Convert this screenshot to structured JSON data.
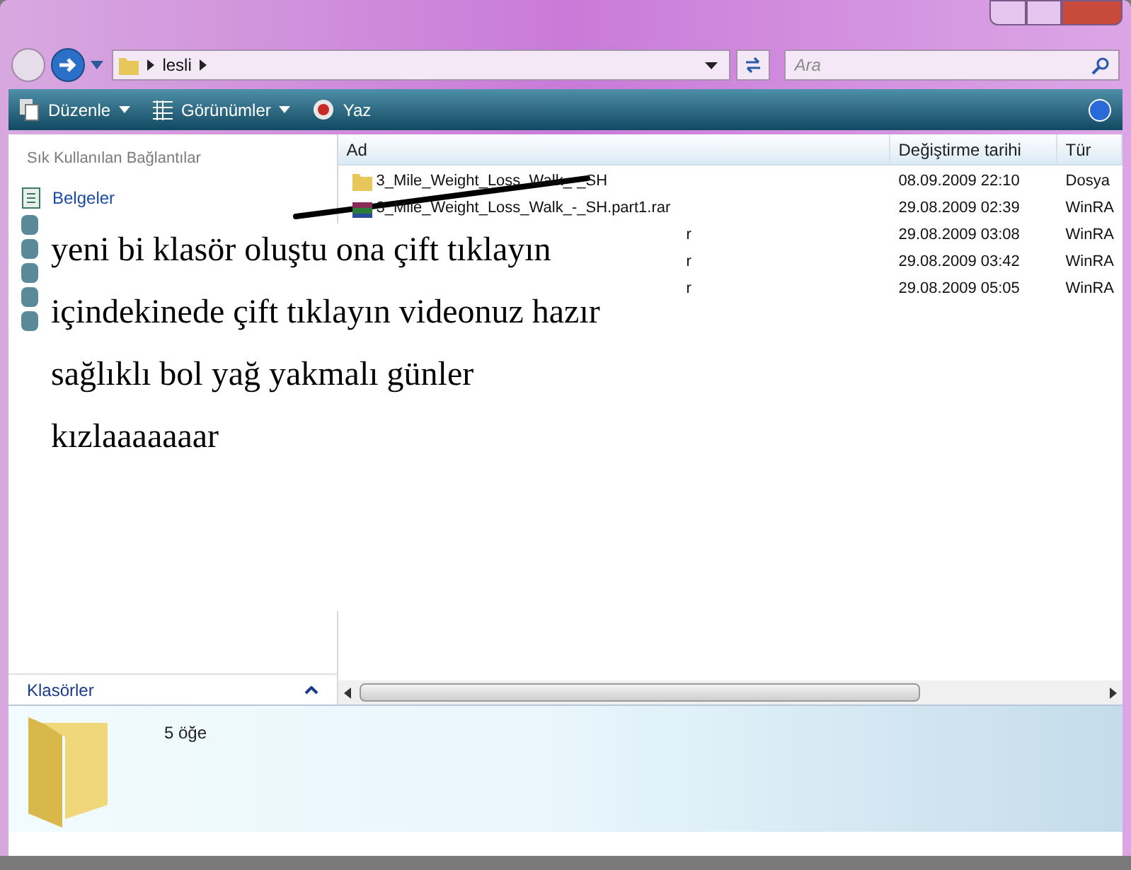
{
  "address": {
    "path": "lesli",
    "search_placeholder": "Ara"
  },
  "toolbar": [
    {
      "label": "Düzenle",
      "kind": "menu"
    },
    {
      "label": "Görünümler",
      "kind": "menu"
    },
    {
      "label": "Yaz",
      "kind": "plain"
    }
  ],
  "sidebar": {
    "heading": "Sık Kullanılan Bağlantılar",
    "items": [
      {
        "label": "Belgeler"
      }
    ],
    "folders_label": "Klasörler"
  },
  "table": {
    "columns": [
      "Ad",
      "Değiştirme tarihi",
      "Tür"
    ],
    "rows": [
      {
        "kind": "folder",
        "name": "3_Mile_Weight_Loss_Walk_-_SH",
        "date": "08.09.2009 22:10",
        "type": "Dosya",
        "obscured": false
      },
      {
        "kind": "archive",
        "name": "3_Mile_Weight_Loss_Walk_-_SH.part1.rar",
        "date": "29.08.2009 02:39",
        "type": "WinRA",
        "obscured": false
      },
      {
        "kind": "archive",
        "name": "r",
        "date": "29.08.2009 03:08",
        "type": "WinRA",
        "obscured": true
      },
      {
        "kind": "archive",
        "name": "r",
        "date": "29.08.2009 03:42",
        "type": "WinRA",
        "obscured": true
      },
      {
        "kind": "archive",
        "name": "r",
        "date": "29.08.2009 05:05",
        "type": "WinRA",
        "obscured": true
      }
    ]
  },
  "details": {
    "count": "5 öğe"
  },
  "note": {
    "lines": [
      "yeni bi klasör oluştu ona çift tıklayın",
      "içindekinede çift tıklayın videonuz hazır",
      "sağlıklı bol yağ yakmalı günler",
      "kızlaaaaaaar"
    ]
  }
}
